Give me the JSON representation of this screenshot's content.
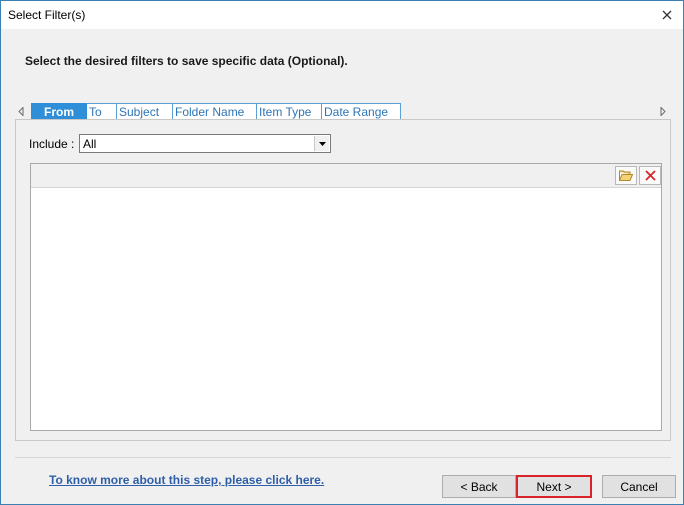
{
  "window": {
    "title": "Select Filter(s)"
  },
  "instruction": "Select the desired filters to save specific data (Optional).",
  "tabs": [
    {
      "label": "From",
      "active": true
    },
    {
      "label": "To",
      "active": false
    },
    {
      "label": "Subject",
      "active": false
    },
    {
      "label": "Folder Name",
      "active": false
    },
    {
      "label": "Item Type",
      "active": false
    },
    {
      "label": "Date Range",
      "active": false
    }
  ],
  "include": {
    "label": "Include :",
    "selected": "All"
  },
  "list": {
    "items": []
  },
  "footer": {
    "help_link": "To know more about this step, please click here.",
    "back_label": "< Back",
    "next_label": "Next >",
    "cancel_label": "Cancel"
  },
  "colors": {
    "accent": "#2e8ed8",
    "tab_text": "#2e75b6",
    "link": "#2e5ea8",
    "highlight_border": "#d9232a"
  },
  "icons": {
    "close": "close-icon",
    "open_folder": "folder-open-icon",
    "delete": "delete-x-icon",
    "dropdown": "chevron-down-icon"
  }
}
